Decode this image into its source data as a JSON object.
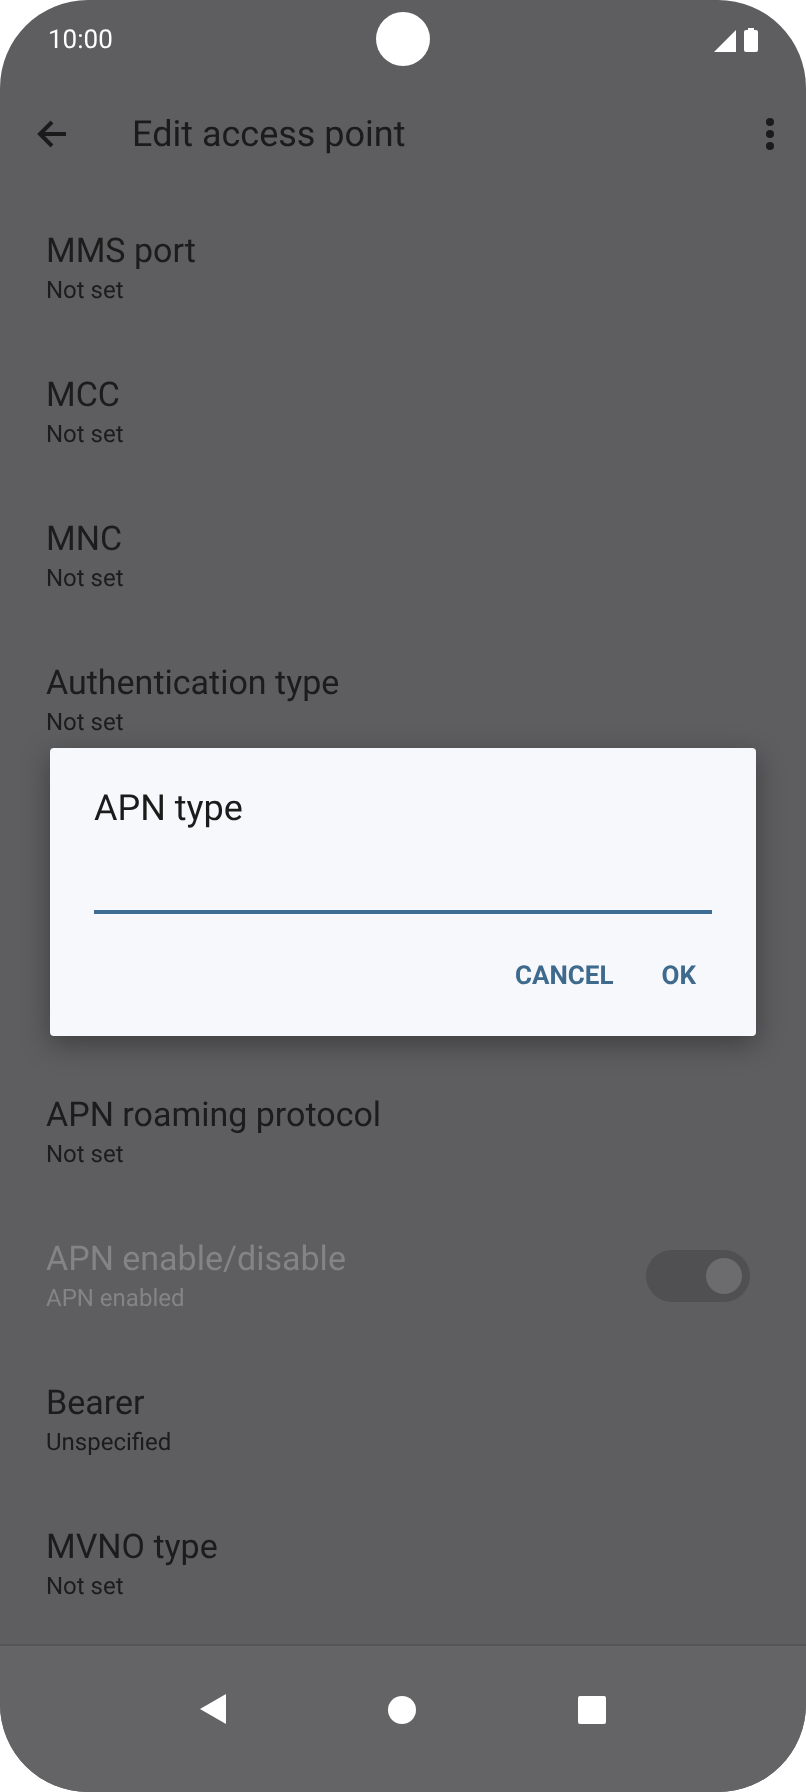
{
  "status_bar": {
    "time": "10:00"
  },
  "app_bar": {
    "title": "Edit access point"
  },
  "settings": [
    {
      "kind": "text",
      "title": "MMS port",
      "summary": "Not set",
      "disabled": false
    },
    {
      "kind": "text",
      "title": "MCC",
      "summary": "Not set",
      "disabled": false
    },
    {
      "kind": "text",
      "title": "MNC",
      "summary": "Not set",
      "disabled": false
    },
    {
      "kind": "text",
      "title": "Authentication type",
      "summary": "Not set",
      "disabled": false
    },
    {
      "kind": "covered"
    },
    {
      "kind": "covered"
    },
    {
      "kind": "text",
      "title": "APN roaming protocol",
      "summary": "Not set",
      "disabled": false
    },
    {
      "kind": "switch",
      "title": "APN enable/disable",
      "summary": "APN enabled",
      "disabled": true,
      "checked": true
    },
    {
      "kind": "text",
      "title": "Bearer",
      "summary": "Unspecified",
      "disabled": false
    },
    {
      "kind": "text",
      "title": "MVNO type",
      "summary": "Not set",
      "disabled": false
    }
  ],
  "dialog": {
    "title": "APN type",
    "buttons": [
      "CANCEL",
      "OK"
    ]
  }
}
